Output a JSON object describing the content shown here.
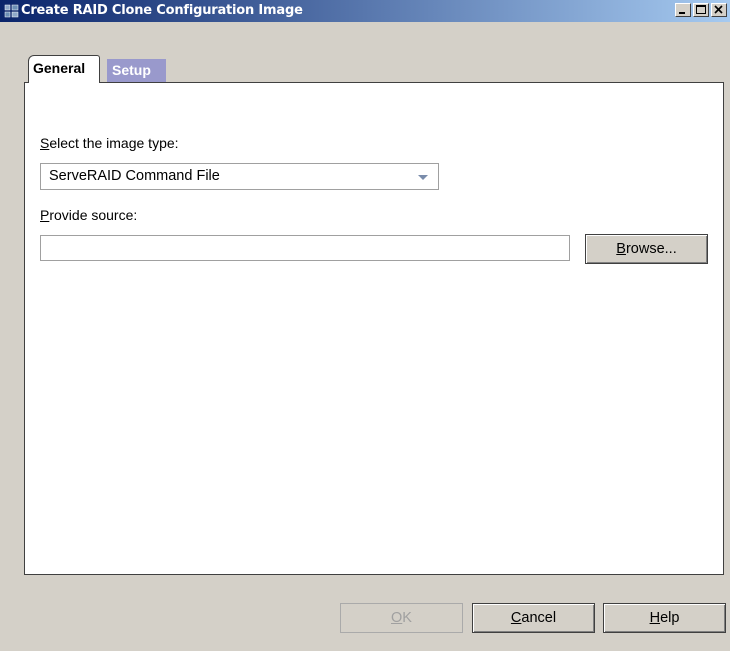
{
  "window": {
    "title": "Create RAID Clone Configuration Image",
    "controls": {
      "minimize": "minimize-icon",
      "maximize": "maximize-icon",
      "close": "close-icon"
    }
  },
  "tabs": [
    {
      "label": "General",
      "selected": true
    },
    {
      "label": "Setup",
      "selected": false
    }
  ],
  "general": {
    "image_type_label": "Select the image type:",
    "image_type_value": "ServeRAID Command File",
    "source_label": "Provide source:",
    "source_value": "",
    "browse_label": "Browse..."
  },
  "footer": {
    "ok_label": "OK",
    "cancel_label": "Cancel",
    "help_label": "Help"
  },
  "colors": {
    "titlebar_start": "#0a246a",
    "titlebar_end": "#a6caf0",
    "tab_unselected": "#9999cc",
    "dialog_bg": "#d4d0c8"
  }
}
